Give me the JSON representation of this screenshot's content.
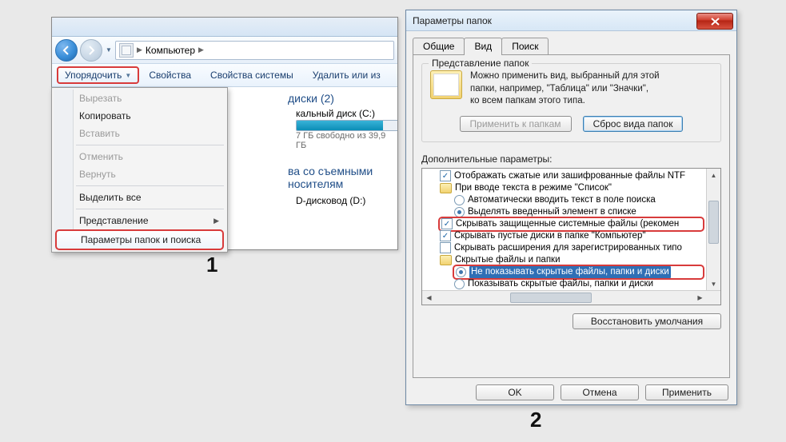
{
  "explorer": {
    "breadcrumb_root": "Компьютер",
    "toolbar": {
      "organize": "Упорядочить",
      "properties": "Свойства",
      "system_properties": "Свойства системы",
      "remove_or": "Удалить или из"
    },
    "menu": {
      "cut": "Вырезать",
      "copy": "Копировать",
      "paste": "Вставить",
      "undo": "Отменить",
      "redo": "Вернуть",
      "select_all": "Выделить все",
      "view": "Представление",
      "folder_options": "Параметры папок и поиска"
    },
    "content": {
      "hdd_header": "диски (2)",
      "drive_c": "кальный диск (C:)",
      "drive_c_free": "7 ГБ свободно из 39,9 ГБ",
      "removable_header": "ва со съемными носителям",
      "drive_d": "D-дисковод (D:)"
    }
  },
  "dialog": {
    "title": "Параметры папок",
    "tabs": {
      "general": "Общие",
      "view": "Вид",
      "search": "Поиск"
    },
    "group_title": "Представление папок",
    "present_text_1": "Можно применить вид, выбранный для этой",
    "present_text_2": "папки, например, \"Таблица\" или \"Значки\",",
    "present_text_3": "ко всем папкам этого типа.",
    "apply_to_folders": "Применить к папкам",
    "reset_folders": "Сброс вида папок",
    "advanced_label": "Дополнительные параметры:",
    "tree": {
      "i0": "Отображать сжатые или зашифрованные файлы NTF",
      "i1": "При вводе текста в режиме \"Список\"",
      "i2": "Автоматически вводить текст в поле поиска",
      "i3": "Выделять введенный элемент в списке",
      "i4": "Скрывать защищенные системные файлы (рекомен",
      "i5": "Скрывать пустые диски в папке \"Компьютер\"",
      "i6": "Скрывать расширения для зарегистрированных типо",
      "i7": "Скрытые файлы и папки",
      "i8": "Не показывать скрытые файлы, папки и диски",
      "i9": "Показывать скрытые файлы, папки и диски"
    },
    "restore_defaults": "Восстановить умолчания",
    "ok": "OK",
    "cancel": "Отмена",
    "apply": "Применить"
  },
  "labels": {
    "one": "1",
    "two": "2"
  }
}
